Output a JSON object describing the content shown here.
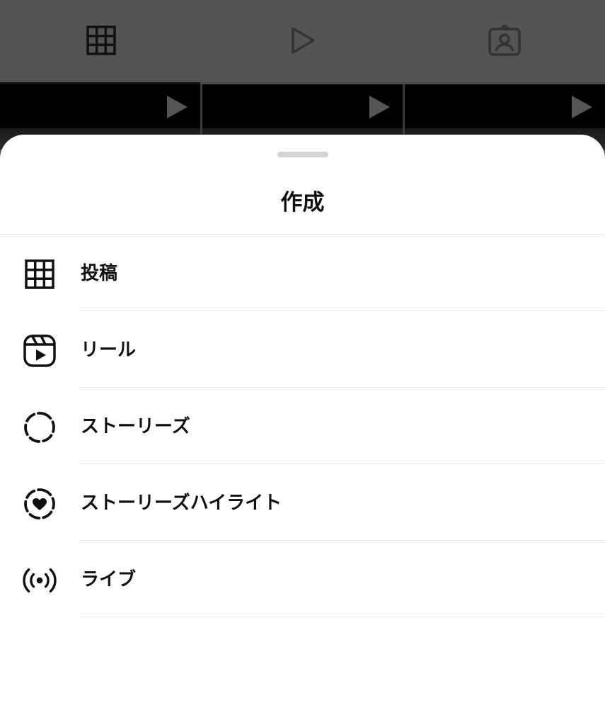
{
  "background_profile": {
    "tabs": [
      {
        "icon": "grid-icon",
        "selected": true
      },
      {
        "icon": "reels-play-icon",
        "selected": false
      },
      {
        "icon": "tagged-person-icon",
        "selected": false
      }
    ],
    "grid_tiles": [
      {
        "icon": "play-icon"
      },
      {
        "icon": "play-icon"
      },
      {
        "icon": "play-icon"
      }
    ]
  },
  "sheet": {
    "title": "作成",
    "items": [
      {
        "label": "投稿",
        "icon": "grid-icon"
      },
      {
        "label": "リール",
        "icon": "reels-icon"
      },
      {
        "label": "ストーリーズ",
        "icon": "story-dashed-circle-icon"
      },
      {
        "label": "ストーリーズハイライト",
        "icon": "highlight-heart-icon"
      },
      {
        "label": "ライブ",
        "icon": "live-broadcast-icon"
      }
    ]
  },
  "colors": {
    "overlay": "#545454",
    "sheet_background": "#ffffff",
    "text": "#111111",
    "divider": "#e4e4e4"
  }
}
